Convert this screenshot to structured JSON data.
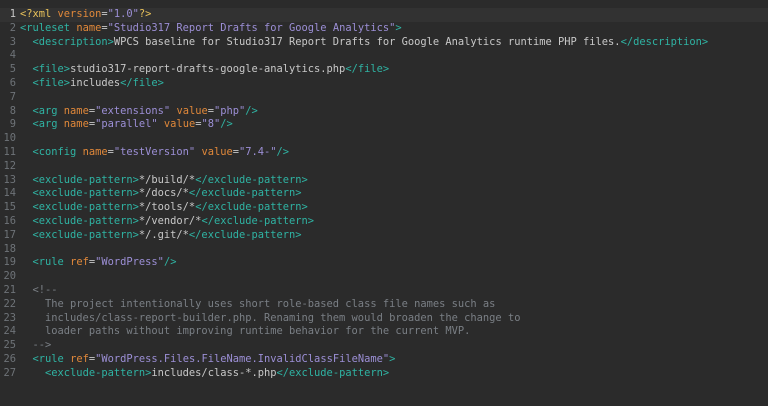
{
  "editor": {
    "active_line": 1,
    "lines": [
      {
        "n": "1",
        "tokens": [
          {
            "t": "decl",
            "v": "<?xml "
          },
          {
            "t": "attr",
            "v": "version"
          },
          {
            "t": "punct",
            "v": "="
          },
          {
            "t": "val",
            "v": "\"1.0\""
          },
          {
            "t": "decl",
            "v": "?>"
          }
        ]
      },
      {
        "n": "2",
        "tokens": [
          {
            "t": "tag",
            "v": "<ruleset "
          },
          {
            "t": "attr",
            "v": "name"
          },
          {
            "t": "punct",
            "v": "="
          },
          {
            "t": "val",
            "v": "\"Studio317 Report Drafts for Google Analytics\""
          },
          {
            "t": "tag",
            "v": ">"
          }
        ]
      },
      {
        "n": "3",
        "tokens": [
          {
            "t": "text",
            "v": "  "
          },
          {
            "t": "tag",
            "v": "<description>"
          },
          {
            "t": "text",
            "v": "WPCS baseline for Studio317 Report Drafts for Google Analytics runtime PHP files."
          },
          {
            "t": "tag",
            "v": "</description>"
          }
        ]
      },
      {
        "n": "4",
        "tokens": []
      },
      {
        "n": "5",
        "tokens": [
          {
            "t": "text",
            "v": "  "
          },
          {
            "t": "tag",
            "v": "<file>"
          },
          {
            "t": "text",
            "v": "studio317-report-drafts-google-analytics.php"
          },
          {
            "t": "tag",
            "v": "</file>"
          }
        ]
      },
      {
        "n": "6",
        "tokens": [
          {
            "t": "text",
            "v": "  "
          },
          {
            "t": "tag",
            "v": "<file>"
          },
          {
            "t": "text",
            "v": "includes"
          },
          {
            "t": "tag",
            "v": "</file>"
          }
        ]
      },
      {
        "n": "7",
        "tokens": []
      },
      {
        "n": "8",
        "tokens": [
          {
            "t": "text",
            "v": "  "
          },
          {
            "t": "tag",
            "v": "<arg "
          },
          {
            "t": "attr",
            "v": "name"
          },
          {
            "t": "punct",
            "v": "="
          },
          {
            "t": "val",
            "v": "\"extensions\""
          },
          {
            "t": "text",
            "v": " "
          },
          {
            "t": "attr",
            "v": "value"
          },
          {
            "t": "punct",
            "v": "="
          },
          {
            "t": "val",
            "v": "\"php\""
          },
          {
            "t": "tag",
            "v": "/>"
          }
        ]
      },
      {
        "n": "9",
        "tokens": [
          {
            "t": "text",
            "v": "  "
          },
          {
            "t": "tag",
            "v": "<arg "
          },
          {
            "t": "attr",
            "v": "name"
          },
          {
            "t": "punct",
            "v": "="
          },
          {
            "t": "val",
            "v": "\"parallel\""
          },
          {
            "t": "text",
            "v": " "
          },
          {
            "t": "attr",
            "v": "value"
          },
          {
            "t": "punct",
            "v": "="
          },
          {
            "t": "val",
            "v": "\"8\""
          },
          {
            "t": "tag",
            "v": "/>"
          }
        ]
      },
      {
        "n": "10",
        "tokens": []
      },
      {
        "n": "11",
        "tokens": [
          {
            "t": "text",
            "v": "  "
          },
          {
            "t": "tag",
            "v": "<config "
          },
          {
            "t": "attr",
            "v": "name"
          },
          {
            "t": "punct",
            "v": "="
          },
          {
            "t": "val",
            "v": "\"testVersion\""
          },
          {
            "t": "text",
            "v": " "
          },
          {
            "t": "attr",
            "v": "value"
          },
          {
            "t": "punct",
            "v": "="
          },
          {
            "t": "val",
            "v": "\"7.4-\""
          },
          {
            "t": "tag",
            "v": "/>"
          }
        ]
      },
      {
        "n": "12",
        "tokens": []
      },
      {
        "n": "13",
        "tokens": [
          {
            "t": "text",
            "v": "  "
          },
          {
            "t": "tag",
            "v": "<exclude-pattern>"
          },
          {
            "t": "text",
            "v": "*/build/*"
          },
          {
            "t": "tag",
            "v": "</exclude-pattern>"
          }
        ]
      },
      {
        "n": "14",
        "tokens": [
          {
            "t": "text",
            "v": "  "
          },
          {
            "t": "tag",
            "v": "<exclude-pattern>"
          },
          {
            "t": "text",
            "v": "*/docs/*"
          },
          {
            "t": "tag",
            "v": "</exclude-pattern>"
          }
        ]
      },
      {
        "n": "15",
        "tokens": [
          {
            "t": "text",
            "v": "  "
          },
          {
            "t": "tag",
            "v": "<exclude-pattern>"
          },
          {
            "t": "text",
            "v": "*/tools/*"
          },
          {
            "t": "tag",
            "v": "</exclude-pattern>"
          }
        ]
      },
      {
        "n": "16",
        "tokens": [
          {
            "t": "text",
            "v": "  "
          },
          {
            "t": "tag",
            "v": "<exclude-pattern>"
          },
          {
            "t": "text",
            "v": "*/vendor/*"
          },
          {
            "t": "tag",
            "v": "</exclude-pattern>"
          }
        ]
      },
      {
        "n": "17",
        "tokens": [
          {
            "t": "text",
            "v": "  "
          },
          {
            "t": "tag",
            "v": "<exclude-pattern>"
          },
          {
            "t": "text",
            "v": "*/.git/*"
          },
          {
            "t": "tag",
            "v": "</exclude-pattern>"
          }
        ]
      },
      {
        "n": "18",
        "tokens": []
      },
      {
        "n": "19",
        "tokens": [
          {
            "t": "text",
            "v": "  "
          },
          {
            "t": "tag",
            "v": "<rule "
          },
          {
            "t": "attr",
            "v": "ref"
          },
          {
            "t": "punct",
            "v": "="
          },
          {
            "t": "val",
            "v": "\"WordPress\""
          },
          {
            "t": "tag",
            "v": "/>"
          }
        ]
      },
      {
        "n": "20",
        "tokens": []
      },
      {
        "n": "21",
        "tokens": [
          {
            "t": "comment",
            "v": "  <!--"
          }
        ]
      },
      {
        "n": "22",
        "tokens": [
          {
            "t": "comment",
            "v": "    The project intentionally uses short role-based class file names such as"
          }
        ]
      },
      {
        "n": "23",
        "tokens": [
          {
            "t": "comment",
            "v": "    includes/class-report-builder.php. Renaming them would broaden the change to"
          }
        ]
      },
      {
        "n": "24",
        "tokens": [
          {
            "t": "comment",
            "v": "    loader paths without improving runtime behavior for the current MVP."
          }
        ]
      },
      {
        "n": "25",
        "tokens": [
          {
            "t": "comment",
            "v": "  -->"
          }
        ]
      },
      {
        "n": "26",
        "tokens": [
          {
            "t": "text",
            "v": "  "
          },
          {
            "t": "tag",
            "v": "<rule "
          },
          {
            "t": "attr",
            "v": "ref"
          },
          {
            "t": "punct",
            "v": "="
          },
          {
            "t": "val",
            "v": "\"WordPress.Files.FileName.InvalidClassFileName\""
          },
          {
            "t": "tag",
            "v": ">"
          }
        ]
      },
      {
        "n": "27",
        "tokens": [
          {
            "t": "text",
            "v": "    "
          },
          {
            "t": "tag",
            "v": "<exclude-pattern>"
          },
          {
            "t": "text",
            "v": "includes/class-*.php"
          },
          {
            "t": "tag",
            "v": "</exclude-pattern>"
          }
        ]
      }
    ]
  }
}
